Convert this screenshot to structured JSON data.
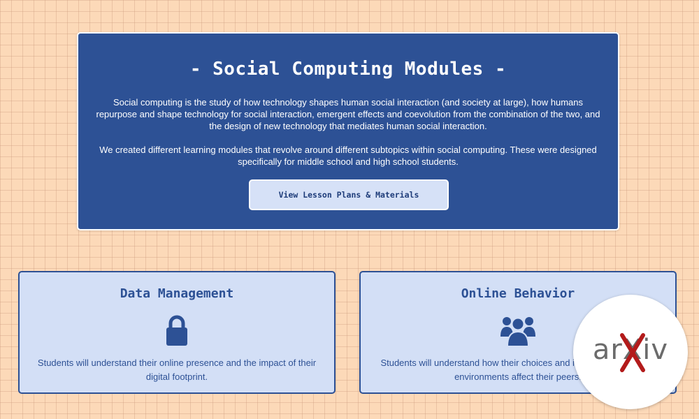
{
  "hero": {
    "title": "- Social Computing Modules -",
    "paragraph1": "Social computing is the study of how technology shapes human social interaction (and society at large), how humans repurpose and shape technology for social interaction, emergent effects and coevolution from the combination of the two, and the design of new technology that mediates human social interaction.",
    "paragraph2": "We created different learning modules that revolve around different subtopics within social computing. These were designed specifically for middle school and high school students.",
    "cta_label": "View Lesson Plans & Materials"
  },
  "cards": [
    {
      "title": "Data Management",
      "icon": "lock-icon",
      "description": "Students will understand their online presence and the impact of their digital footprint."
    },
    {
      "title": "Online Behavior",
      "icon": "users-icon",
      "description": "Students will understand how their choices and interactions in online environments affect their peers."
    }
  ],
  "badge": {
    "text": "arXiv",
    "icon": "arxiv-logo"
  },
  "colors": {
    "background": "#fcd9b8",
    "primary": "#2d5195",
    "card_bg": "#d3dff6",
    "button_bg": "#d6e1f7",
    "arxiv_red": "#b31b1b"
  }
}
